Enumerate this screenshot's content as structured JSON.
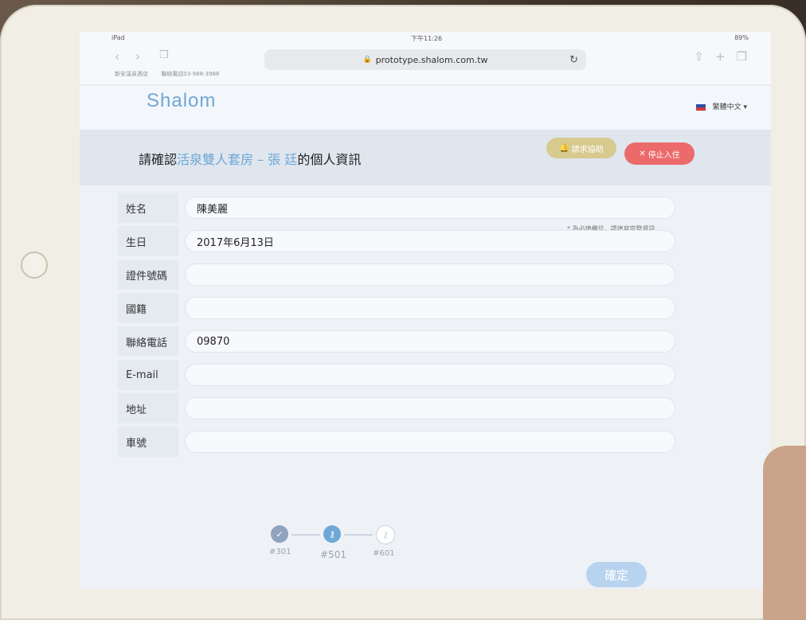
{
  "status": {
    "carrier": "iPad",
    "time": "下午11:26",
    "battery": "89%"
  },
  "safari": {
    "url": "prototype.shalom.com.tw",
    "hotel_name": "新安溫泉酒店",
    "hotel_phone": "聯絡電話03-988-3988"
  },
  "header": {
    "logo": "Shalom",
    "language": "繁體中文"
  },
  "banner": {
    "title_prefix": "請確認",
    "room": "活泉雙人套房 – 張",
    "guest_suffix": "廷",
    "title_suffix": "的個人資訊",
    "help_label": "請求協助",
    "stop_label": "停止入住"
  },
  "form": {
    "required_note": "* 為必填欄位，請填寫完整資訊",
    "fields": [
      {
        "label": "姓名",
        "value": "陳美麗"
      },
      {
        "label": "生日",
        "value": "2017年6月13日"
      },
      {
        "label": "證件號碼",
        "value": ""
      },
      {
        "label": "國籍",
        "value": ""
      },
      {
        "label": "聯絡電話",
        "value": "09870"
      },
      {
        "label": "E-mail",
        "value": ""
      },
      {
        "label": "地址",
        "value": ""
      },
      {
        "label": "車號",
        "value": ""
      }
    ]
  },
  "progress": {
    "steps": [
      {
        "label": "#301",
        "state": "done",
        "icon": "check-icon"
      },
      {
        "label": "#501",
        "state": "current",
        "icon": "key-icon"
      },
      {
        "label": "#601",
        "state": "pending",
        "icon": "key-icon"
      }
    ]
  },
  "confirm_label": "確定",
  "colors": {
    "accent": "#6ea8d6",
    "help": "#d8c98f",
    "stop": "#ec6a6a",
    "confirm": "#b8d3ef"
  }
}
